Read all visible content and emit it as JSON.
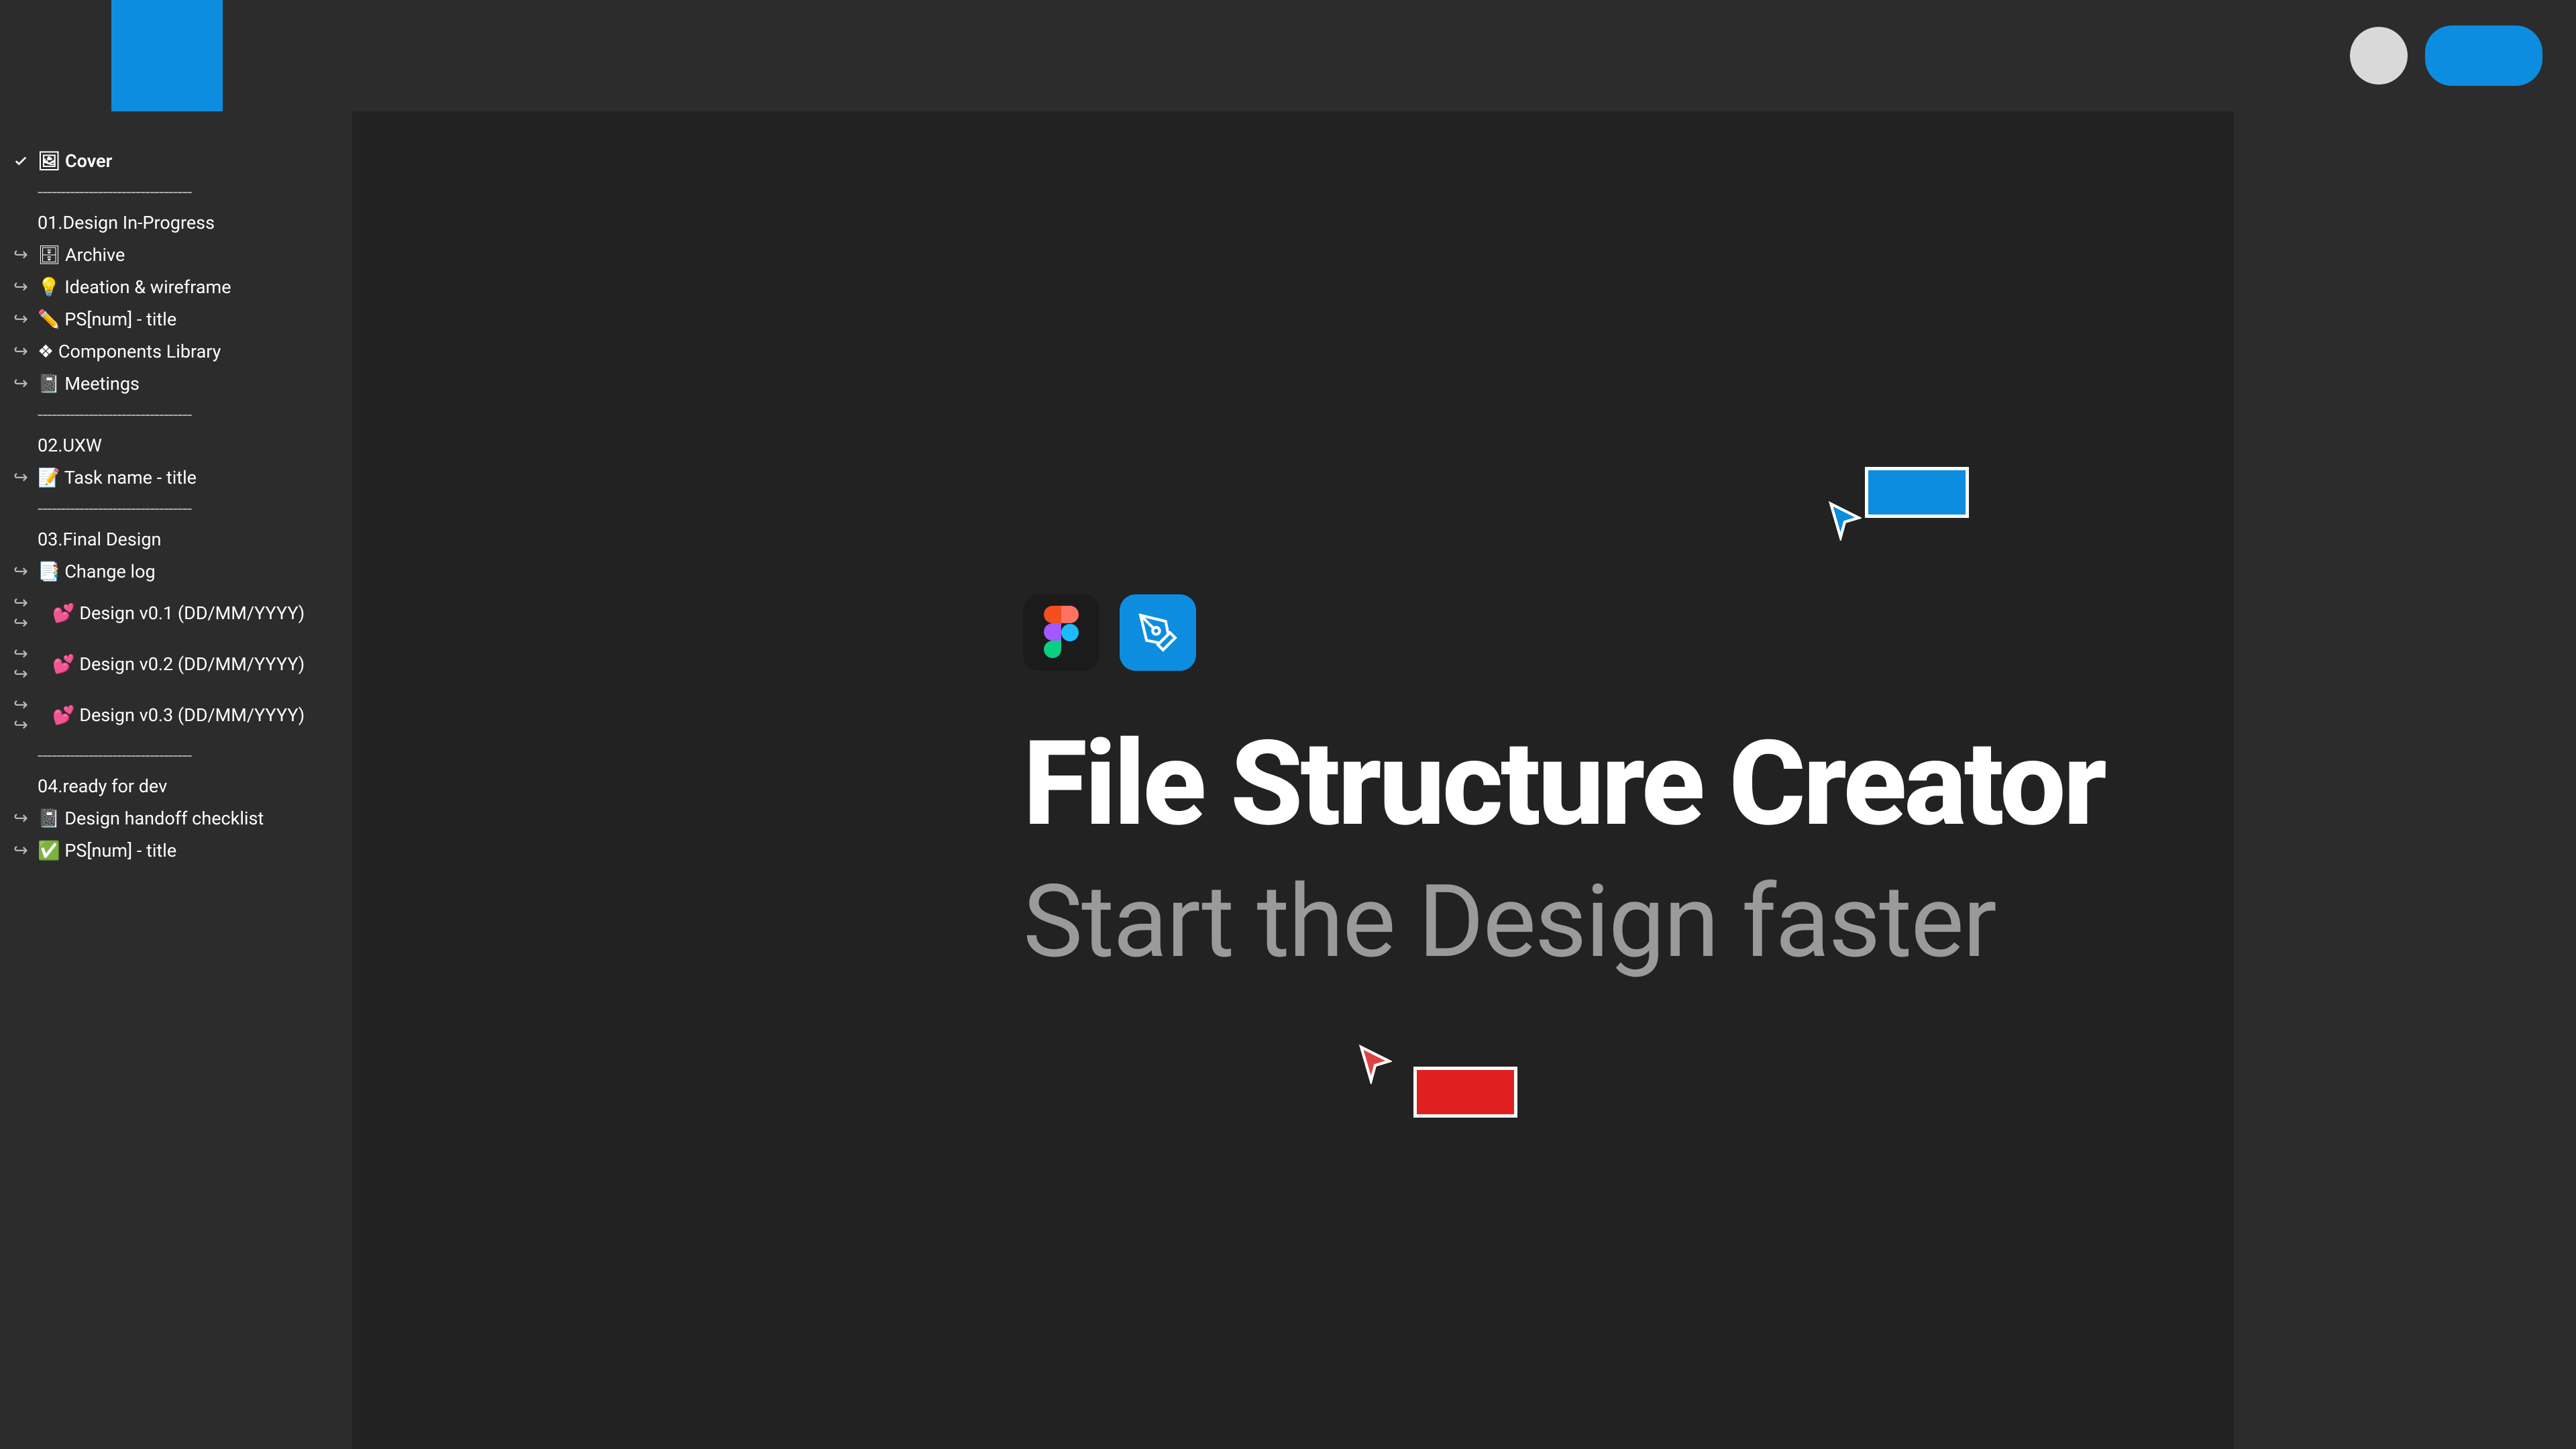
{
  "colors": {
    "accent": "#0d8de0",
    "danger_cursor": "#e02020",
    "bg_dark": "#2c2c2c",
    "canvas": "#222222",
    "subtitle": "#9a9a9a"
  },
  "topbar": {
    "logo": "blue-square"
  },
  "hero": {
    "title": "File Structure Creator",
    "subtitle": "Start the Design faster"
  },
  "sidebar": {
    "selected_page": "🖼 Cover",
    "dividers": "---------------------------------",
    "sections": [
      {
        "heading": "01.Design In-Progress",
        "items": [
          {
            "label": "🗄 Archive",
            "depth": 1
          },
          {
            "label": "💡 Ideation & wireframe",
            "depth": 1
          },
          {
            "label": "✏️ PS[num] - title",
            "depth": 1
          },
          {
            "label": "❖ Components Library",
            "depth": 1
          },
          {
            "label": "📓 Meetings",
            "depth": 1
          }
        ]
      },
      {
        "heading": "02.UXW",
        "items": [
          {
            "label": "📝 Task name - title",
            "depth": 1
          }
        ]
      },
      {
        "heading": "03.Final Design",
        "items": [
          {
            "label": "📑 Change log",
            "depth": 1
          },
          {
            "label": "💕 Design v0.1 (DD/MM/YYYY)",
            "depth": 2
          },
          {
            "label": "💕 Design v0.2 (DD/MM/YYYY)",
            "depth": 2
          },
          {
            "label": "💕 Design v0.3 (DD/MM/YYYY)",
            "depth": 2
          }
        ]
      },
      {
        "heading": "04.ready for dev",
        "items": [
          {
            "label": "📓 Design handoff checklist",
            "depth": 1
          },
          {
            "label": "✅ PS[num] - title",
            "depth": 1
          }
        ]
      }
    ]
  }
}
